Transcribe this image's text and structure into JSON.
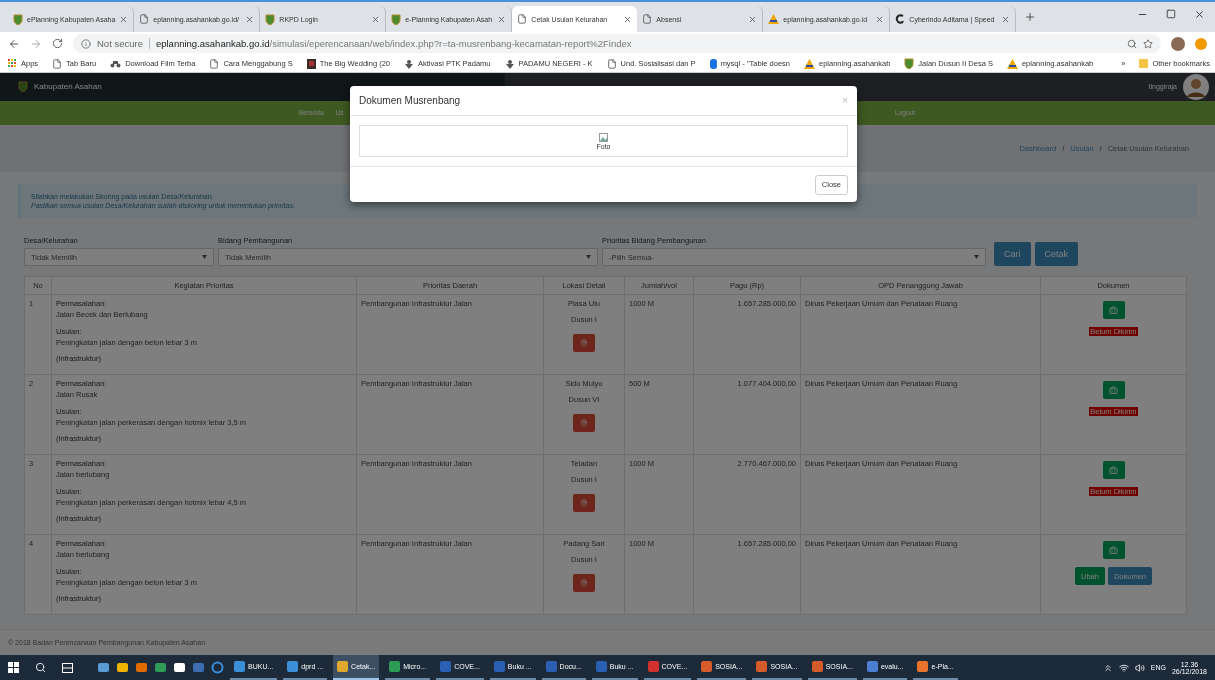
{
  "tabs": [
    {
      "title": "ePlanning Kabupaten Asaha",
      "kind": "crest",
      "selected": false
    },
    {
      "title": "eplanning.asahankab.go.id/",
      "kind": "page",
      "selected": false
    },
    {
      "title": "RKPD Login",
      "kind": "crest",
      "selected": false
    },
    {
      "title": "e-Planning Kabupaten Asah",
      "kind": "crest",
      "selected": false
    },
    {
      "title": "Cetak Usulan Kelurahan",
      "kind": "page",
      "selected": true
    },
    {
      "title": "Absensi",
      "kind": "page",
      "selected": false
    },
    {
      "title": "eplanning.asahankab.go.id",
      "kind": "pma",
      "selected": false
    },
    {
      "title": "Cyberindo Aditama | Speed",
      "kind": "cyber",
      "selected": false
    }
  ],
  "address": {
    "security": "Not secure",
    "host": "eplanning.asahankab.go.id",
    "path": "/simulasi/eperencanaan/web/index.php?r=ta-musrenbang-kecamatan-report%2Findex"
  },
  "bookmarks": [
    {
      "label": "Apps",
      "kind": "apps"
    },
    {
      "label": "Tab Baru",
      "kind": "page"
    },
    {
      "label": "Download Film Terba",
      "kind": "bike"
    },
    {
      "label": "Cara Menggabung S",
      "kind": "page"
    },
    {
      "label": "The Big Wedding (20",
      "kind": "film"
    },
    {
      "label": "Aktivasi PTK Padamu",
      "kind": "emblem"
    },
    {
      "label": "PADAMU NEGERI - K",
      "kind": "emblem"
    },
    {
      "label": "Und. Sosialisasi dan P",
      "kind": "page"
    },
    {
      "label": "mysql - \"Table doesn",
      "kind": "db"
    },
    {
      "label": "eplanning.asahankab",
      "kind": "pma"
    },
    {
      "label": "Jalan Dusun II Desa S",
      "kind": "crest"
    },
    {
      "label": "eplanning.asahankab",
      "kind": "pma"
    }
  ],
  "bookmarks_more": "»",
  "other_bookmarks": "Other bookmarks",
  "header": {
    "brand": "Kabupaten Asahan",
    "user": "tinggiraja"
  },
  "nav": [
    "Beranda",
    "Us",
    "Logout"
  ],
  "breadcrumb": [
    "Dashboard",
    "/",
    "Usulan",
    "/",
    "Cetak Usulan Kelurahan"
  ],
  "alert": {
    "message": "Silahkan melakukan Skoring pada usulan Desa/Kelurahan.",
    "hint": "Pastikan semua usulan Desa/Kelurahan sudah diskoring untuk menentukan prioritas."
  },
  "filters": [
    {
      "label": "Desa/Kelurahan",
      "value": "Tidak Memilih"
    },
    {
      "label": "Bidang Pembangunan",
      "value": "Tidak Memilih"
    },
    {
      "label": "Prioritas Bidang Pembangunan",
      "value": "-Pilih Semua-"
    }
  ],
  "buttons": [
    "Cari",
    "Cetak"
  ],
  "table": {
    "columns": [
      "No",
      "Kegiatan Prioritas",
      "Prioritas Daerah",
      "Lokasi Detail",
      "Jumlah/vol",
      "Pagu (Rp)",
      "OPD Penanggung Jawab",
      "Dokumen"
    ],
    "rows": [
      {
        "no": "1",
        "problem_label": "Permasalahan:",
        "problem": "Jalan Becek dan Berlubang",
        "proposal_label": "Usulan:",
        "proposal": "Peningkatan jalan dengan beton lebar 3 m",
        "category": "(Infrastruktur)",
        "priority": "Pembangunan Infrastruktur Jalan",
        "location": [
          "Piasa Ulu",
          "Dusun I"
        ],
        "volume": "1000 M",
        "budget": "1.657.285.000,00",
        "agency": "Dinas Pekerjaan Umum dan Penataan Ruang",
        "document": {
          "kind": "status",
          "status": "Belum Dikirim"
        }
      },
      {
        "no": "2",
        "problem_label": "Permasalahan:",
        "problem": "Jalan Rusak",
        "proposal_label": "Usulan:",
        "proposal": "Peningkatan jalan perkerasan dengan hotmix lebar 3,5 m",
        "category": "(Infrastruktur)",
        "priority": "Pembangunan Infrastruktur Jalan",
        "location": [
          "Sido Mulyo",
          "Dusun VI"
        ],
        "volume": "500 M",
        "budget": "1.077.404.000,00",
        "agency": "Dinas Pekerjaan Umum dan Penataan Ruang",
        "document": {
          "kind": "status",
          "status": "Belum Dikirim"
        }
      },
      {
        "no": "3",
        "problem_label": "Permasalahan:",
        "problem": "Jalan berlubang",
        "proposal_label": "Usulan:",
        "proposal": "Peningkatan jalan perkerasan dengan hotmix lebar 4,5 m",
        "category": "(Infrastruktur)",
        "priority": "Pembangunan Infrastruktur Jalan",
        "location": [
          "Teladan",
          "Dusun I"
        ],
        "volume": "1000 M",
        "budget": "2.770.467.000,00",
        "agency": "Dinas Pekerjaan Umum dan Penataan Ruang",
        "document": {
          "kind": "status",
          "status": "Belum Dikirim"
        }
      },
      {
        "no": "4",
        "problem_label": "Permasalahan:",
        "problem": "Jalan berlubang",
        "proposal_label": "Usulan:",
        "proposal": "Peningkatan jalan dengan beton lebar 3 m",
        "category": "(Infrastruktur)",
        "priority": "Pembangunan Infrastruktur Jalan",
        "location": [
          "Padang Sari",
          "Dusun I"
        ],
        "volume": "1000 M",
        "budget": "1.657.285.000,00",
        "agency": "Dinas Pekerjaan Umum dan Penataan Ruang",
        "document": {
          "kind": "actions",
          "buttons": [
            "Ubah",
            "Dokumen"
          ]
        }
      }
    ]
  },
  "footer": "© 2018 Badan Perencanaan Pembangunan Kabupaten Asahan",
  "modal": {
    "title": "Dokumen Musrenbang",
    "close_icon": "×",
    "image_alt": "Foto",
    "close_button": "Close"
  },
  "taskbar": {
    "apps": [
      {
        "label": "BUKU...",
        "color": "#3b8fd9",
        "selected": false
      },
      {
        "label": "dprd ...",
        "color": "#3b8fd9",
        "selected": false
      },
      {
        "label": "Cetak...",
        "color": "#e0a82e",
        "selected": true
      },
      {
        "label": "Micro...",
        "color": "#2e9b57",
        "selected": false
      },
      {
        "label": "COVE...",
        "color": "#2b5fb4",
        "selected": false
      },
      {
        "label": "Buku ...",
        "color": "#2b5fb4",
        "selected": false
      },
      {
        "label": "Docu...",
        "color": "#2b5fb4",
        "selected": false
      },
      {
        "label": "Buku ...",
        "color": "#2b5fb4",
        "selected": false
      },
      {
        "label": "COVE...",
        "color": "#d2322d",
        "selected": false
      },
      {
        "label": "SOSIA...",
        "color": "#d55b2a",
        "selected": false
      },
      {
        "label": "SOSIA...",
        "color": "#d55b2a",
        "selected": false
      },
      {
        "label": "SOSIA...",
        "color": "#d55b2a",
        "selected": false
      },
      {
        "label": "evalu...",
        "color": "#4a7fd1",
        "selected": false
      },
      {
        "label": "e-Pla...",
        "color": "#e8732c",
        "selected": false
      }
    ],
    "language": "ENG",
    "time": "12.36",
    "date": "26/12/2018"
  }
}
